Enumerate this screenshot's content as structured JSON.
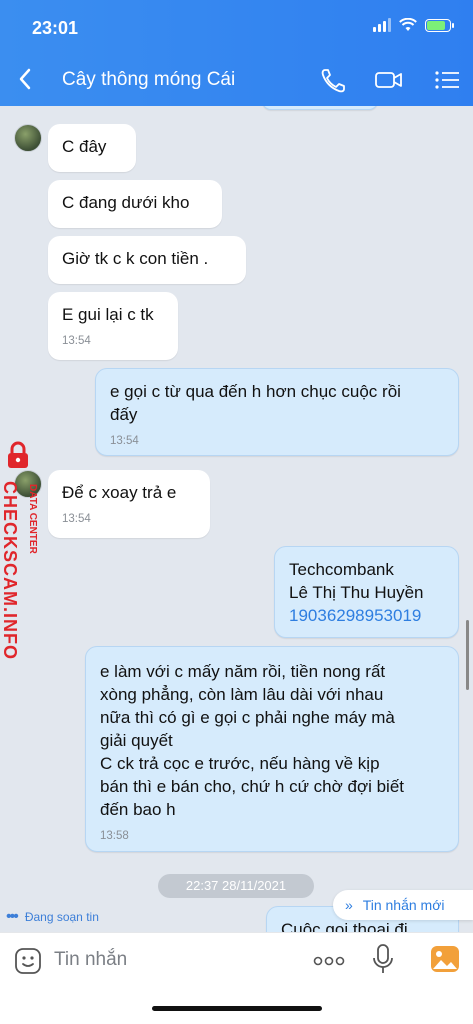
{
  "status_bar": {
    "time": "23:01"
  },
  "header": {
    "title": "Cây thông móng Cái",
    "icons": [
      "back-arrow-icon",
      "phone-icon",
      "video-call-icon",
      "menu-list-icon"
    ]
  },
  "watermark": {
    "brand": "CHECKSCAM.INFO",
    "sub": "DATA CENTER"
  },
  "messages": [
    {
      "from": "them",
      "text": "C đây"
    },
    {
      "from": "them",
      "text": "C đang dưới kho"
    },
    {
      "from": "them",
      "text": "Giờ tk c k con tiền ."
    },
    {
      "from": "them",
      "text": "E gui lại c tk",
      "time": "13:54"
    },
    {
      "from": "me",
      "text": "e gọi c từ qua đến h hơn chục cuộc rồi\nđấy",
      "time": "13:54"
    },
    {
      "from": "them",
      "text": "Để c xoay trả e",
      "time": "13:54"
    },
    {
      "from": "me",
      "text": "Techcombank\nLê Thị Thu Huyền",
      "link": "19036298953019"
    },
    {
      "from": "me",
      "text": "e làm với c mấy năm rồi, tiền nong rất\nxòng phẳng, còn làm lâu dài với nhau\nnữa thì có gì e gọi c phải nghe máy mà\ngiải quyết\nC ck trả cọc e trước, nếu hàng về kịp\nbán thì e bán cho, chứ h cứ chờ đợi biết\nđến bao h",
      "time": "13:58"
    },
    {
      "from": "me",
      "text": "Cuộc gọi thoại đi"
    }
  ],
  "date_divider": "22:37 28/11/2021",
  "typing_indicator": "Đang soạn tin",
  "new_messages_button": "Tin nhắn mới",
  "input": {
    "placeholder": "Tin nhắn"
  },
  "colors": {
    "header": "#2f7ff0",
    "outgoing_bubble": "#d6ebfc",
    "link": "#2e7ee0",
    "watermark": "#e0262b"
  }
}
